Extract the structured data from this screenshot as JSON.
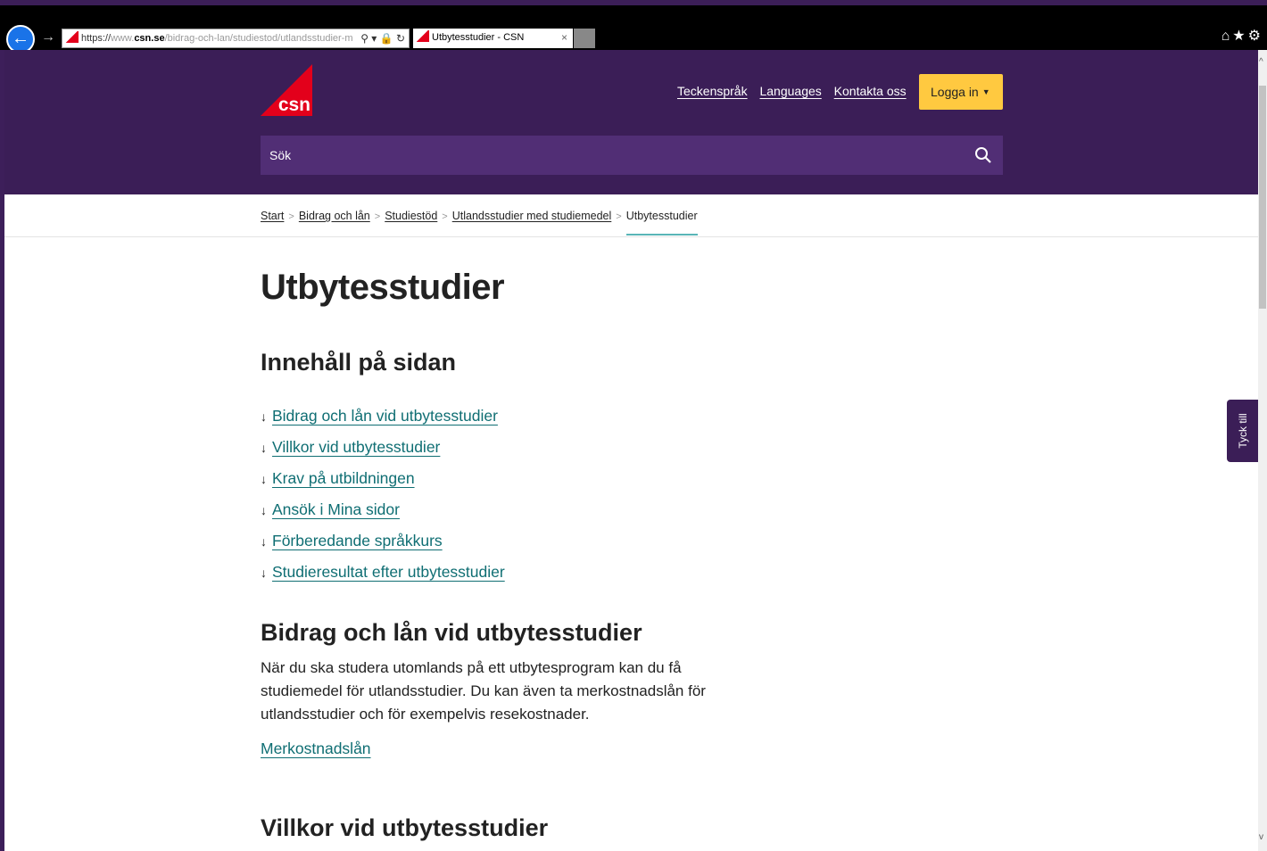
{
  "browser": {
    "url_protocol": "https://",
    "url_prefix": "www.",
    "url_host": "csn.se",
    "url_path": "/bidrag-och-lan/studiestod/utlandsstudier-m",
    "url_tools": "⚲ ▾ 🔒 ↻",
    "tab_title": "Utbytesstudier - CSN",
    "tab_close": "×",
    "toolbar_icons": "⌂★⚙"
  },
  "header": {
    "logo_text": "csn",
    "links": [
      "Teckenspråk",
      "Languages",
      "Kontakta oss"
    ],
    "login_label": "Logga in",
    "search_label": "Sök"
  },
  "breadcrumb": {
    "items": [
      "Start",
      "Bidrag och lån",
      "Studiestöd",
      "Utlandsstudier med studiemedel"
    ],
    "current": "Utbytesstudier"
  },
  "page": {
    "title": "Utbytesstudier",
    "toc_title": "Innehåll på sidan",
    "toc": [
      "Bidrag och lån vid utbytesstudier",
      "Villkor vid utbytesstudier",
      "Krav på utbildningen",
      "Ansök i Mina sidor",
      "Förberedande språkkurs",
      "Studieresultat efter utbytesstudier"
    ],
    "section1_title": "Bidrag och lån vid utbytesstudier",
    "section1_text": "När du ska studera utomlands på ett utbytesprogram kan du få studiemedel för utlandsstudier. Du kan även ta merkostnadslån för utlandsstudier och för exempelvis resekostnader.",
    "section1_link": "Merkostnadslån",
    "section2_title": "Villkor vid utbytesstudier"
  },
  "feedback_label": "Tyck till",
  "colors": {
    "brand_purple": "#3b1e57",
    "search_purple": "#512e75",
    "login_yellow": "#ffc940",
    "link_teal": "#0f6e73",
    "logo_red": "#e3001b"
  }
}
